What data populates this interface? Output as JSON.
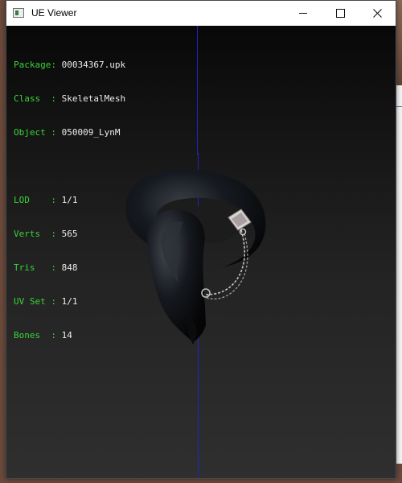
{
  "window": {
    "title": "UE Viewer"
  },
  "info_panel": {
    "group1": [
      {
        "key": "Package:",
        "value": "00034367.upk"
      },
      {
        "key": "Class  :",
        "value": "SkeletalMesh"
      },
      {
        "key": "Object :",
        "value": "050009_LynM"
      }
    ],
    "group2": [
      {
        "key": "LOD    :",
        "value": "1/1"
      },
      {
        "key": "Verts  :",
        "value": "565"
      },
      {
        "key": "Tris   :",
        "value": "848"
      },
      {
        "key": "UV Set :",
        "value": "1/1"
      },
      {
        "key": "Bones  :",
        "value": "14"
      }
    ]
  },
  "colors": {
    "info_key": "#37d437",
    "info_value": "#ececec",
    "axis": "#2323c8",
    "viewport_top": "#080808",
    "viewport_bottom": "#2f2f2f"
  },
  "icons": {
    "app": "app-window-icon",
    "minimize": "minimize-icon",
    "maximize": "maximize-icon",
    "close": "close-icon"
  }
}
